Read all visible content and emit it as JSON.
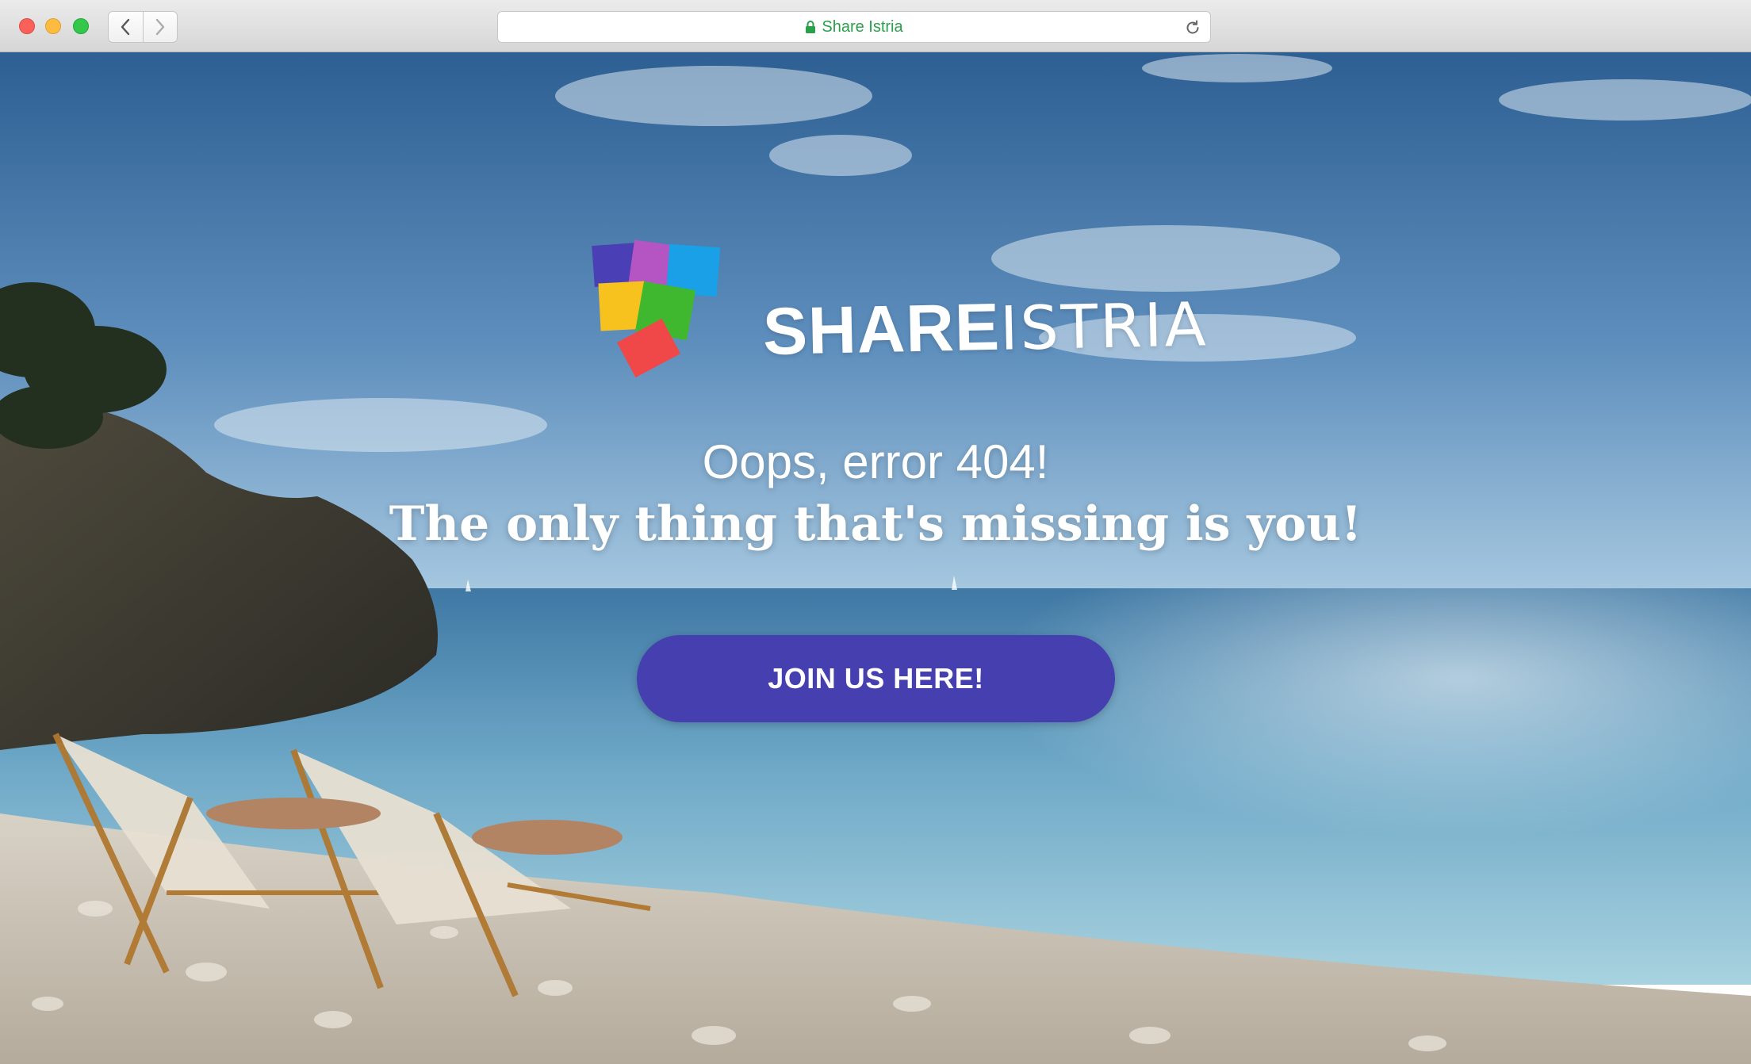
{
  "browser": {
    "address_text": "Share Istria",
    "icons": {
      "close": "close-window-icon",
      "minimize": "minimize-window-icon",
      "zoom": "zoom-window-icon",
      "back": "chevron-left-icon",
      "forward": "chevron-right-icon",
      "lock": "lock-icon",
      "reload": "reload-icon"
    },
    "colors": {
      "secure_text": "#2aa04a",
      "close": "#fc605b",
      "minimize": "#fdbc40",
      "zoom": "#34c84a"
    }
  },
  "page": {
    "logo": {
      "word_bold": "SHARE",
      "word_light": "ISTRIA",
      "tile_colors": [
        "#4a3fb5",
        "#b555c4",
        "#1aa0e6",
        "#f7c21d",
        "#3fb82f",
        "#f04848"
      ]
    },
    "headline": "Oops, error 404!",
    "subheadline": "The only thing that's missing is you!",
    "cta_label": "JOIN US HERE!",
    "colors": {
      "cta_background": "#463fb0",
      "text": "#ffffff"
    }
  }
}
